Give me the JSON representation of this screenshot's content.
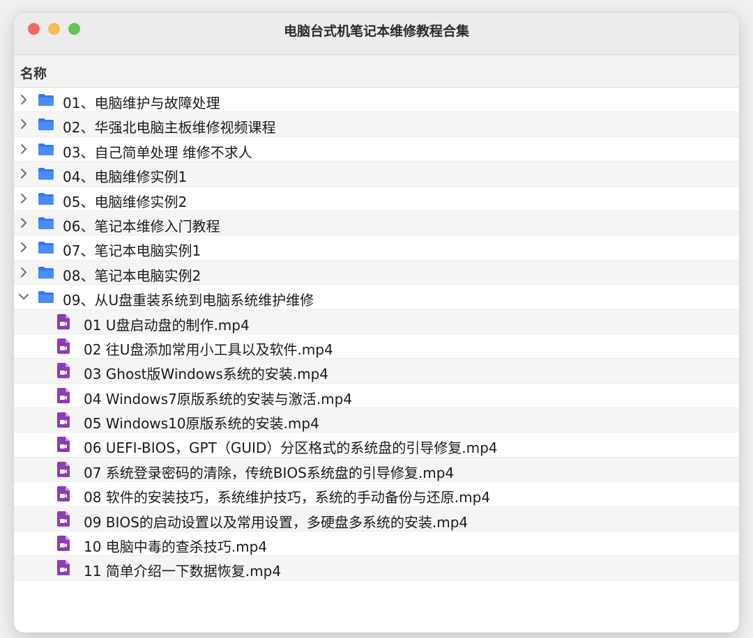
{
  "window": {
    "title": "电脑台式机笔记本维修教程合集"
  },
  "header": {
    "name_column": "名称"
  },
  "folders": [
    {
      "label": "01、电脑维护与故障处理",
      "expanded": false
    },
    {
      "label": "02、华强北电脑主板维修视频课程",
      "expanded": false
    },
    {
      "label": "03、自己简单处理 维修不求人",
      "expanded": false
    },
    {
      "label": "04、电脑维修实例1",
      "expanded": false
    },
    {
      "label": "05、电脑维修实例2",
      "expanded": false
    },
    {
      "label": "06、笔记本维修入门教程",
      "expanded": false
    },
    {
      "label": "07、笔记本电脑实例1",
      "expanded": false
    },
    {
      "label": "08、笔记本电脑实例2",
      "expanded": false
    },
    {
      "label": "09、从U盘重装系统到电脑系统维护维修",
      "expanded": true
    }
  ],
  "files": [
    "01 U盘启动盘的制作.mp4",
    "02 往U盘添加常用小工具以及软件.mp4",
    "03 Ghost版Windows系统的安装.mp4",
    "04 Windows7原版系统的安装与激活.mp4",
    "05 Windows10原版系统的安装.mp4",
    "06 UEFI-BIOS，GPT（GUID）分区格式的系统盘的引导修复.mp4",
    "07 系统登录密码的清除，传统BIOS系统盘的引导修复.mp4",
    "08 软件的安装技巧，系统维护技巧，系统的手动备份与还原.mp4",
    "09 BIOS的启动设置以及常用设置，多硬盘多系统的安装.mp4",
    "10 电脑中毒的查杀技巧.mp4",
    "11 简单介绍一下数据恢复.mp4"
  ],
  "colors": {
    "folder": "#3478f6",
    "file": "#8e3bb5",
    "close": "#ee6a5f",
    "minimize": "#f5be4f",
    "maximize": "#62c655"
  },
  "icons": {
    "folder": "folder-icon",
    "file": "video-file-icon",
    "collapsed": "chevron-right-icon",
    "expanded": "chevron-down-icon"
  }
}
